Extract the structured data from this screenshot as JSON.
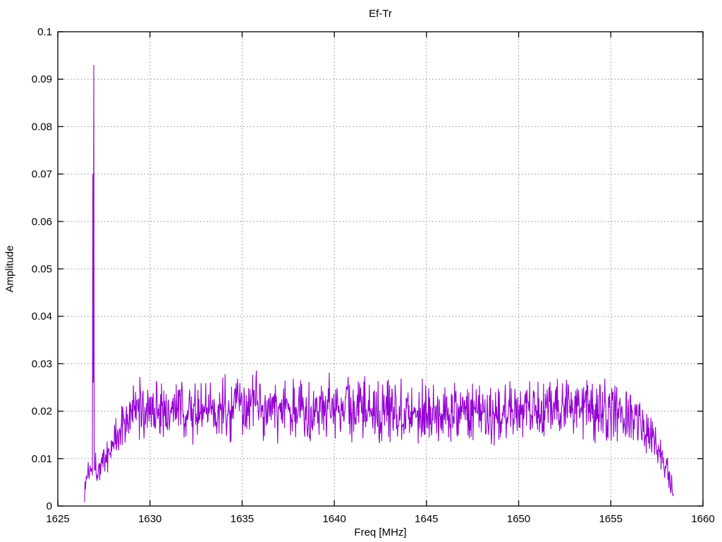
{
  "window": {
    "background": "#ffffff"
  },
  "chart_data": {
    "type": "line",
    "title": "Ef-Tr",
    "xlabel": "Freq [MHz]",
    "ylabel": "Amplitude",
    "xlim": [
      1625,
      1660
    ],
    "ylim": [
      0,
      0.1
    ],
    "grid": true,
    "legend": "none",
    "colors": {
      "line": "#9400d3",
      "grid": "#8c8c8c",
      "axis": "#000000",
      "text": "#000000"
    },
    "xticks": [
      {
        "v": 1625,
        "label": "1625"
      },
      {
        "v": 1630,
        "label": "1630"
      },
      {
        "v": 1635,
        "label": "1635"
      },
      {
        "v": 1640,
        "label": "1640"
      },
      {
        "v": 1645,
        "label": "1645"
      },
      {
        "v": 1650,
        "label": "1650"
      },
      {
        "v": 1655,
        "label": "1655"
      },
      {
        "v": 1660,
        "label": "1660"
      }
    ],
    "yticks": [
      {
        "v": 0,
        "label": "0"
      },
      {
        "v": 0.01,
        "label": "0.01"
      },
      {
        "v": 0.02,
        "label": "0.02"
      },
      {
        "v": 0.03,
        "label": "0.03"
      },
      {
        "v": 0.04,
        "label": "0.04"
      },
      {
        "v": 0.05,
        "label": "0.05"
      },
      {
        "v": 0.06,
        "label": "0.06"
      },
      {
        "v": 0.07,
        "label": "0.07"
      },
      {
        "v": 0.08,
        "label": "0.08"
      },
      {
        "v": 0.09,
        "label": "0.09"
      },
      {
        "v": 0.1,
        "label": "0.1"
      }
    ],
    "series": [
      {
        "name": "Ef-Tr",
        "color": "#9400d3",
        "description": "Noisy amplitude spectrum: signal band from ~1626.5 to ~1658.4 MHz, noise plateau near 0.02, narrow carrier spike at ~1626.9 MHz peaking at 0.093, roll-off at band edges.",
        "x_start": 1626.45,
        "x_end": 1658.42,
        "x_step": 0.025,
        "envelope": [
          [
            1626.45,
            0.0025
          ],
          [
            1626.55,
            0.006
          ],
          [
            1626.7,
            0.008
          ],
          [
            1627.0,
            0.008
          ],
          [
            1627.3,
            0.0085
          ],
          [
            1627.6,
            0.01
          ],
          [
            1627.9,
            0.0125
          ],
          [
            1628.2,
            0.015
          ],
          [
            1628.8,
            0.019
          ],
          [
            1629.5,
            0.0205
          ],
          [
            1631.0,
            0.0205
          ],
          [
            1632.5,
            0.0198
          ],
          [
            1634.0,
            0.0205
          ],
          [
            1635.5,
            0.0212
          ],
          [
            1637.0,
            0.0202
          ],
          [
            1638.5,
            0.0206
          ],
          [
            1640.0,
            0.0212
          ],
          [
            1641.5,
            0.02
          ],
          [
            1643.0,
            0.0206
          ],
          [
            1644.5,
            0.0206
          ],
          [
            1646.0,
            0.0198
          ],
          [
            1647.5,
            0.0196
          ],
          [
            1649.0,
            0.02
          ],
          [
            1650.5,
            0.0208
          ],
          [
            1652.0,
            0.0212
          ],
          [
            1653.5,
            0.0204
          ],
          [
            1655.0,
            0.02
          ],
          [
            1656.0,
            0.0194
          ],
          [
            1656.7,
            0.018
          ],
          [
            1657.2,
            0.0156
          ],
          [
            1657.7,
            0.0116
          ],
          [
            1658.1,
            0.0068
          ],
          [
            1658.42,
            0.0024
          ]
        ],
        "noise_amplitude": 0.0078,
        "noise_seed": 1337,
        "spike": {
          "x": 1626.9,
          "shoulder": 0.07,
          "mid_dip": 0.026,
          "peak": 0.093,
          "post_value": 0.009
        }
      }
    ]
  }
}
